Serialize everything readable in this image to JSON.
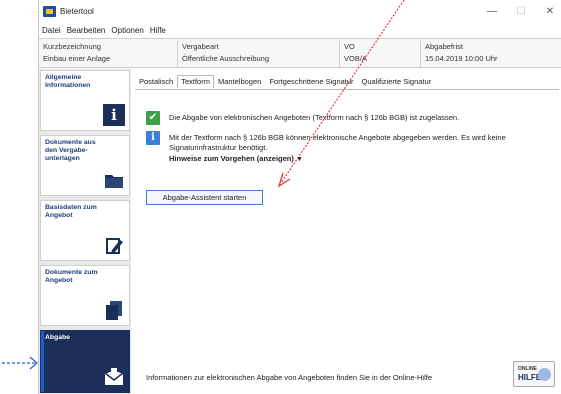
{
  "window": {
    "title": "Bietertool"
  },
  "menubar": [
    "Datei",
    "Bearbeiten",
    "Optionen",
    "Hilfe"
  ],
  "infobar": [
    {
      "label": "Kurzbezeichnung",
      "value": "Einbau einer Anlage"
    },
    {
      "label": "Vergabeart",
      "value": "Öffentliche Ausschreibung"
    },
    {
      "label": "VO",
      "value": "VOB/A"
    },
    {
      "label": "Abgabefrist",
      "value": "15.04.2019 10:00 Uhr"
    }
  ],
  "sidebar": {
    "items": [
      {
        "label": "Allgemeine Informationen",
        "icon": "info-icon"
      },
      {
        "label": "Dokumente aus den Vergabe-unterlagen",
        "icon": "folder-icon"
      },
      {
        "label": "Basisdaten zum Angebot",
        "icon": "edit-document-icon"
      },
      {
        "label": "Dokumente zum Angebot",
        "icon": "documents-icon"
      },
      {
        "label": "Abgabe",
        "icon": "envelope-submit-icon",
        "active": true
      }
    ]
  },
  "tabs": [
    "Postalisch",
    "Textform",
    "Mantelbogen",
    "Fortgeschrittene Signatur",
    "Qualifizierte Signatur"
  ],
  "active_tab": "Textform",
  "panel": {
    "allowed_message": "Die Abgabe von elektronischen Angeboten (Textform nach § 126b BGB) ist zugelassen.",
    "info_message": "Mit der Textform nach § 126b BGB können elektronische Angebote abgegeben werden. Es wird keine Signaturinfrastruktur benötigt.",
    "hint_toggle": "Hinweise zum Vorgehen (anzeigen)",
    "start_button": "Abgabe-Assistent starten",
    "footer_text": "Informationen zur elektronischen Abgabe von Angeboten finden Sie in der Online-Hilfe",
    "online_help": {
      "small": "ONLINE",
      "big": "HILFE"
    }
  },
  "colors": {
    "nav_dark": "#1c2f5a",
    "success_green": "#3da14a",
    "info_blue": "#3b7fd6",
    "annotation_red": "#e03030",
    "annotation_blue": "#1b5fcf"
  }
}
